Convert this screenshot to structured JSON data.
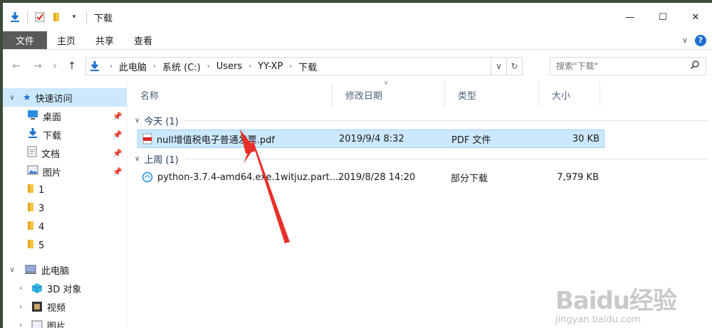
{
  "window": {
    "title": "下载",
    "controls": {
      "minimize": "—",
      "maximize": "☐",
      "close": "✕"
    }
  },
  "ribbon": {
    "tabs": [
      "文件",
      "主页",
      "共享",
      "查看"
    ]
  },
  "address": {
    "crumbs": [
      "此电脑",
      "系统 (C:)",
      "Users",
      "YY-XP",
      "下载"
    ],
    "search_placeholder": "搜索\"下载\""
  },
  "sidebar": {
    "quick_access": "快速访问",
    "pinned": [
      {
        "label": "桌面",
        "icon": "desktop-icon"
      },
      {
        "label": "下载",
        "icon": "download-icon"
      },
      {
        "label": "文档",
        "icon": "document-icon"
      },
      {
        "label": "图片",
        "icon": "pictures-icon"
      }
    ],
    "folders": [
      "1",
      "3",
      "4",
      "5"
    ],
    "this_pc": "此电脑",
    "pc_items": [
      {
        "label": "3D 对象",
        "icon": "3d-objects-icon"
      },
      {
        "label": "视频",
        "icon": "video-icon"
      },
      {
        "label": "图片",
        "icon": "pictures-icon"
      }
    ]
  },
  "columns": {
    "name": "名称",
    "date": "修改日期",
    "type": "类型",
    "size": "大小"
  },
  "groups": [
    {
      "label": "今天 (1)",
      "files": [
        {
          "name": "null增值税电子普通发票.pdf",
          "date": "2019/9/4 8:32",
          "type": "PDF 文件",
          "size": "30 KB",
          "selected": true
        }
      ]
    },
    {
      "label": "上周 (1)",
      "files": [
        {
          "name": "python-3.7.4-amd64.exe.1witjuz.part...",
          "date": "2019/8/28 14:20",
          "type": "部分下载",
          "size": "7,979 KB",
          "selected": false
        }
      ]
    }
  ],
  "watermark": {
    "logo": "Baidu经验",
    "url": "jingyan.baidu.com"
  },
  "colors": {
    "selection": "#cce8ff",
    "selection_border": "#99d1ff",
    "accent": "#1e6fd0",
    "arrow": "#e8302a"
  }
}
